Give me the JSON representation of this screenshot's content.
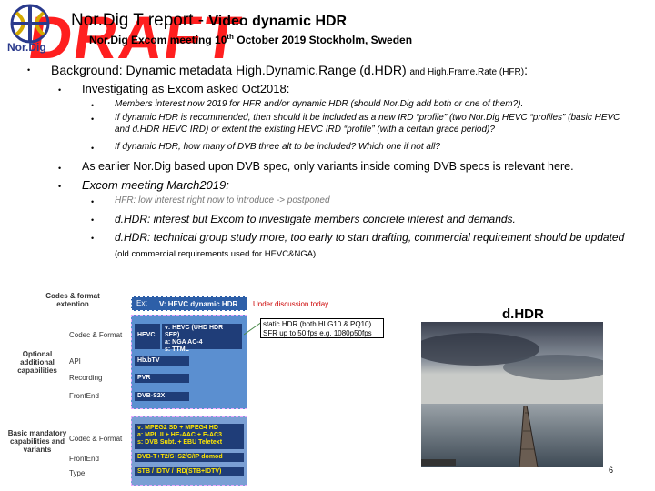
{
  "header": {
    "title_main": "Nor.Dig T report -",
    "title_topic": "Video dynamic HDR",
    "subtitle_prefix": "Nor.Dig Excom meeting 10",
    "subtitle_sup": "th",
    "subtitle_suffix": "October 2019 Stockholm, Sweden",
    "watermark": "DRAFT",
    "logo_text": "Nor.Dig"
  },
  "content": {
    "level1": "Background: Dynamic metadata High.Dynamic.Range (d.HDR)",
    "level1_small": "and High.Frame.Rate (HFR)",
    "level1_colon": ":",
    "item1": "Investigating as Excom asked Oct2018:",
    "item1_sub": [
      "Members interest now 2019 for HFR and/or dynamic HDR (should Nor.Dig add both or one of them?).",
      "If dynamic HDR is recommended, then should it be included as a new IRD “profile” (two Nor.Dig HEVC “profiles” (basic HEVC and d.HDR HEVC IRD) or extent the existing HEVC IRD “profile” (with a certain grace period)?",
      "If dynamic HDR, how many of DVB three alt to be included? Which one if not all?"
    ],
    "item2": "As earlier Nor.Dig based upon DVB spec, only variants inside coming DVB specs is relevant here.",
    "item3": "Excom meeting March2019:",
    "item3_sub1": "HFR: low interest right now to introduce -> postponed",
    "item3_sub2": "d.HDR: interest but Excom to investigate members concrete interest and demands.",
    "item3_sub3_main": "d.HDR: technical group study more, too early to start drafting, commercial requirement should be updated",
    "item3_sub3_small": "(old commercial requirements used for HEVC&NGA)"
  },
  "diagram": {
    "codes_ext": "Codes & format extention",
    "ext_label": "Ext",
    "ext_box": "V: HEVC dynamic HDR",
    "optional": "Optional additional capabilities",
    "basic": "Basic mandatory capabilities and variants",
    "row_codec1": "Codec & Format",
    "row_api": "API",
    "row_recording": "Recording",
    "row_frontend1": "FrontEnd",
    "row_codec2": "Codec & Format",
    "row_frontend2": "FrontEnd",
    "row_type": "Type",
    "hevc": "HEVC",
    "hevc_detail": [
      "v: HEVC (UHD HDR SFR)",
      "a: NGA AC-4",
      "s: TTML"
    ],
    "hbbtv": "Hb.bTV",
    "pvr": "PVR",
    "dvbs2x": "DVB-S2X",
    "basic_lines": [
      "v: MPEG2 SD + MPEG4 HD",
      "a: MPL.II + HE-AAC + E-AC3",
      "s: DVB Subt. + EBU Teletext"
    ],
    "frontend_basic": "DVB-T+T2/S+S2/C/IP domod",
    "type_basic": "STB / IDTV / IRD(STB+IDTV)"
  },
  "annotations": {
    "under_discussion": "Under discussion today",
    "static_note_1": "static HDR (both HLG10 & PQ10)",
    "static_note_2": "SFR up to 50 fps e.g. 1080p50fps",
    "dhdr": "d.HDR",
    "page_number": "6"
  }
}
